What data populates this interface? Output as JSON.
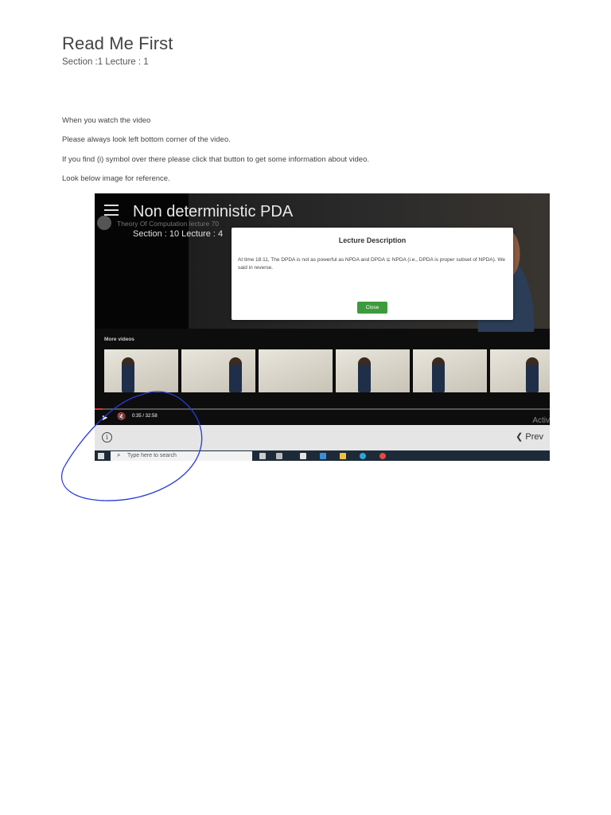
{
  "page": {
    "title": "Read Me First",
    "subtitle": "Section :1   Lecture : 1",
    "paragraphs": [
      "When you watch the video",
      "Please always look left bottom corner of the video.",
      "If you find (i) symbol over there please click that button to get some information about video.",
      "Look below image for reference."
    ]
  },
  "screenshot": {
    "video_title": "Non deterministic PDA",
    "channel_name": "Theory Of Computation lecture 70",
    "section_lecture": "Section : 10  Lecture : 4",
    "modal": {
      "title": "Lecture Description",
      "text": "At time 18:11, The DPDA is not as powerful as NPDA and DPDA ⊊ NPDA (i.e., DPDA is proper subset of NPDA). We said in reverse.",
      "close_label": "Close"
    },
    "more_videos_label": "More videos",
    "time_readout": "0:35 / 32:58",
    "progress_fraction": 0.018,
    "activate_text": "Activ",
    "prev_label": "Prev",
    "taskbar_search_placeholder": "Type here to search",
    "info_icon": "info-icon",
    "annotation_color": "#2a3bd6"
  }
}
